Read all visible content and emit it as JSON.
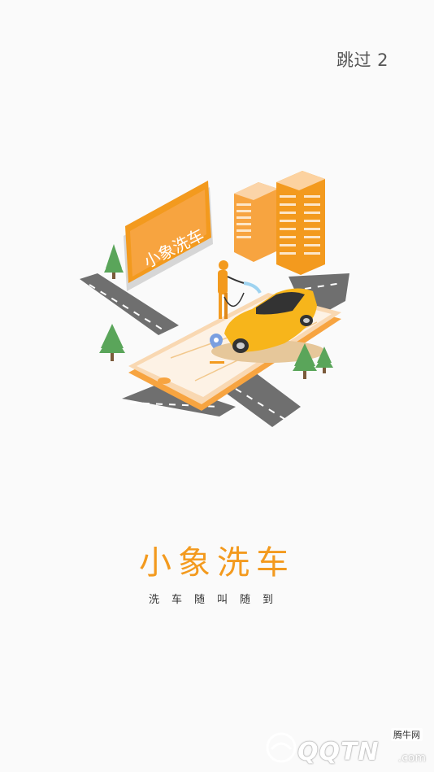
{
  "skip": {
    "label": "跳过 2"
  },
  "illustration": {
    "sign_text": "小象洗车"
  },
  "brand": {
    "title": "小象洗车",
    "slogan": "洗车随叫随到"
  },
  "watermark": {
    "site_cn": "腾牛网",
    "site_en": "QQTN",
    "site_suffix": ".com"
  },
  "colors": {
    "accent": "#f39a1e",
    "background": "#fafafa"
  }
}
